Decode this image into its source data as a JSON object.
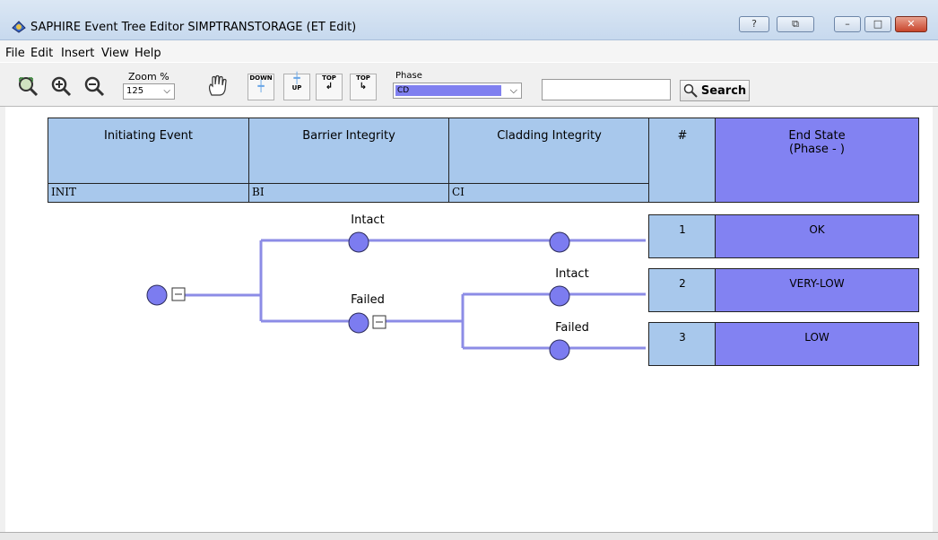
{
  "window": {
    "title": "SAPHIRE Event Tree Editor SIMPTRANSTORAGE (ET Edit)",
    "controls": [
      "?",
      "minimize",
      "maximize",
      "close"
    ]
  },
  "menu": [
    "File",
    "Edit",
    "Insert",
    "View",
    "Help"
  ],
  "toolbar": {
    "zoom_label": "Zoom %",
    "zoom_value": "125",
    "down_label": "DOWN",
    "up_label": "UP",
    "top_label": "TOP",
    "phase_label": "Phase",
    "phase_value": "CD",
    "search_value": "",
    "search_label": "Search"
  },
  "tree": {
    "columns": [
      {
        "title": "Initiating Event",
        "code": "INIT"
      },
      {
        "title": "Barrier Integrity",
        "code": "BI"
      },
      {
        "title": "Cladding Integrity",
        "code": "CI"
      }
    ],
    "seq_header": "#",
    "end_state_header": "End State",
    "end_state_subheader": "(Phase - )",
    "branches": {
      "bi_intact": "Intact",
      "bi_failed": "Failed",
      "ci_intact": "Intact",
      "ci_failed": "Failed"
    },
    "sequences": [
      {
        "num": "1",
        "end_state": "OK"
      },
      {
        "num": "2",
        "end_state": "VERY-LOW"
      },
      {
        "num": "3",
        "end_state": "LOW"
      }
    ]
  },
  "colors": {
    "header_fill": "#a8c8ec",
    "end_state_fill": "#8282f2",
    "branch_line": "#8c8ce6",
    "node_fill": "#7c7cf0"
  }
}
